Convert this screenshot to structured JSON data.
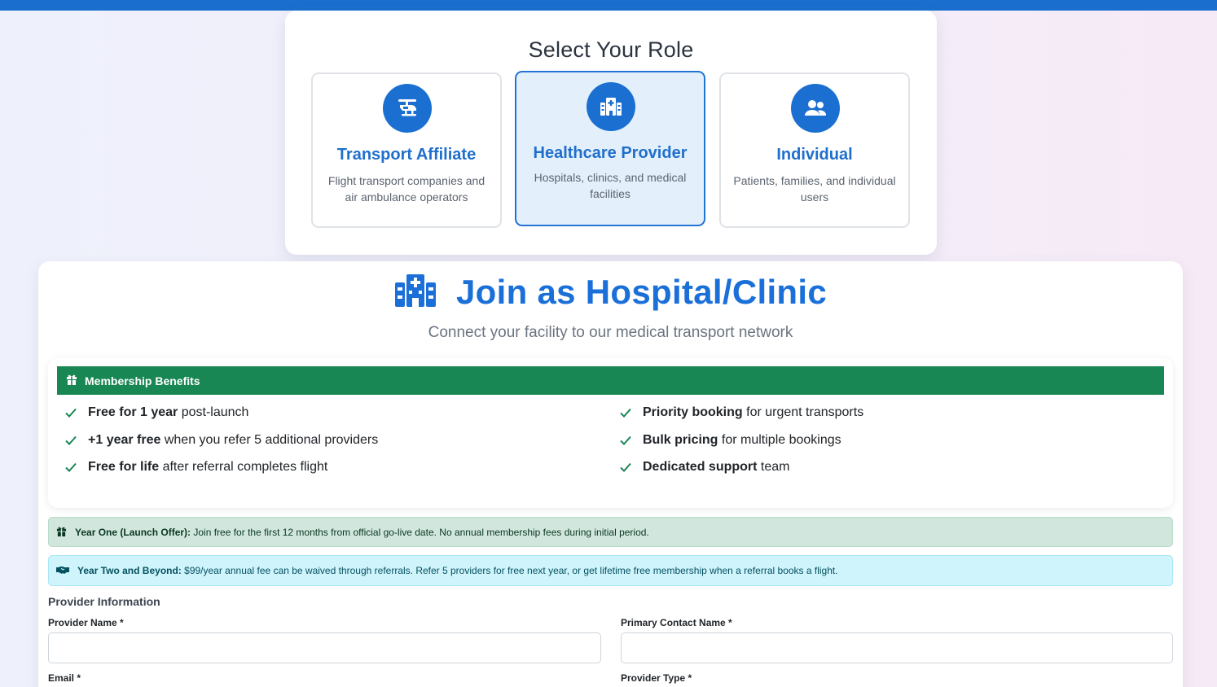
{
  "role_selector": {
    "title": "Select Your Role",
    "options": [
      {
        "name": "Transport Affiliate",
        "description": "Flight transport companies and air ambulance operators",
        "icon": "helicopter-icon"
      },
      {
        "name": "Healthcare Provider",
        "description": "Hospitals, clinics, and medical facilities",
        "icon": "hospital-icon",
        "selected": true
      },
      {
        "name": "Individual",
        "description": "Patients, families, and individual users",
        "icon": "users-icon"
      }
    ]
  },
  "join": {
    "title": "Join as Hospital/Clinic",
    "subtitle": "Connect your facility to our medical transport network"
  },
  "benefits": {
    "heading": "Membership Benefits",
    "items": [
      {
        "bold": "Free for 1 year",
        "rest": " post-launch"
      },
      {
        "bold": "+1 year free",
        "rest": " when you refer 5 additional providers"
      },
      {
        "bold": "Free for life",
        "rest": " after referral completes flight"
      },
      {
        "bold": "Priority booking",
        "rest": " for urgent transports"
      },
      {
        "bold": "Bulk pricing",
        "rest": " for multiple bookings"
      },
      {
        "bold": "Dedicated support",
        "rest": " team"
      }
    ]
  },
  "alerts": {
    "year_one": {
      "bold": "Year One (Launch Offer):",
      "text": " Join free for the first 12 months from official go-live date. No annual membership fees during initial period."
    },
    "year_two": {
      "bold": "Year Two and Beyond:",
      "text": " $99/year annual fee can be waived through referrals. Refer 5 providers for free next year, or get lifetime free membership when a referral books a flight."
    }
  },
  "form": {
    "section": "Provider Information",
    "provider_name_label": "Provider Name *",
    "primary_contact_label": "Primary Contact Name *",
    "email_label": "Email *",
    "provider_type_label": "Provider Type *",
    "provider_name_value": "",
    "primary_contact_value": ""
  },
  "colors": {
    "primary": "#1b6fd0",
    "success": "#198754",
    "topbar": "#1a6fce"
  }
}
